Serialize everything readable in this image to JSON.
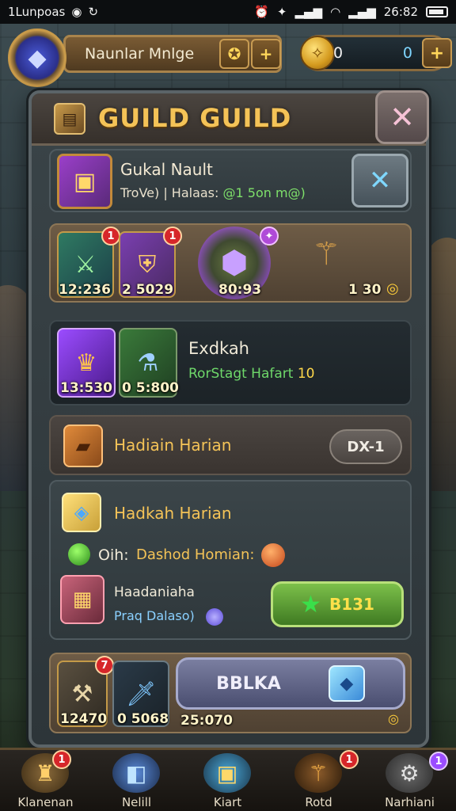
{
  "status_bar": {
    "left_text": "1Lunpoas",
    "time": "26:82"
  },
  "hud": {
    "player_name": "Naunlar Mnlge",
    "currency_left": "0",
    "currency_right": "0",
    "plus_glyph": "+",
    "gold_icon": "coin-icon"
  },
  "panel": {
    "title": "GUILD GUILD",
    "close_glyph": "✕"
  },
  "vault": {
    "title": "Gukal Nault",
    "subtitle_prefix": "TroVe) | Halaas:",
    "subtitle_value": "@1 5on m@)",
    "close_glyph": "✕"
  },
  "items_row": {
    "items": [
      {
        "icon": "sword-icon",
        "value": "12:236",
        "badge": "1"
      },
      {
        "icon": "armor-icon",
        "value": "2 5029",
        "badge": "1"
      },
      {
        "icon": "gem-icon",
        "value": "80:93",
        "badge": ""
      },
      {
        "icon": "staff-icon",
        "value": "1 30",
        "badge": ""
      }
    ]
  },
  "exchange": {
    "title": "Exdkah",
    "subtitle": "RorStagt Hafart",
    "subtitle_value": "10",
    "items": [
      {
        "icon": "horn-icon",
        "value": "13:530"
      },
      {
        "icon": "potion-icon",
        "value": "0 5:800"
      }
    ]
  },
  "daily_one": {
    "title": "Hadiain Harian",
    "button_label": "DX-1"
  },
  "daily_two": {
    "title": "Hadkah Harian",
    "line1_label": "Oih:",
    "line1_value": "Dashod Homian:",
    "reward_title": "Haadaniaha",
    "reward_sub": "Praq Dalaso)",
    "claim_label": "B131"
  },
  "bottom_row": {
    "items": [
      {
        "icon": "axe-icon",
        "value": "12470",
        "badge": "7"
      },
      {
        "icon": "blade-icon",
        "value": "0 5068",
        "badge": ""
      }
    ],
    "big_button_label": "BBLKA",
    "big_button_value": "25:070"
  },
  "nav": [
    {
      "label": "Klanenan",
      "icon": "guild-icon",
      "badge": "1"
    },
    {
      "label": "Nelill",
      "icon": "cube-icon",
      "badge": ""
    },
    {
      "label": "Kiart",
      "icon": "chest-icon",
      "badge": ""
    },
    {
      "label": "Rotd",
      "icon": "relic-icon",
      "badge": "1"
    },
    {
      "label": "Narhiani",
      "icon": "gear-icon",
      "badge": "1"
    }
  ],
  "colors": {
    "title_gold": "#f4c357",
    "badge_red": "#d6262a",
    "claim_green": "#4f8a2c",
    "accent_purple": "#9b4cff"
  }
}
